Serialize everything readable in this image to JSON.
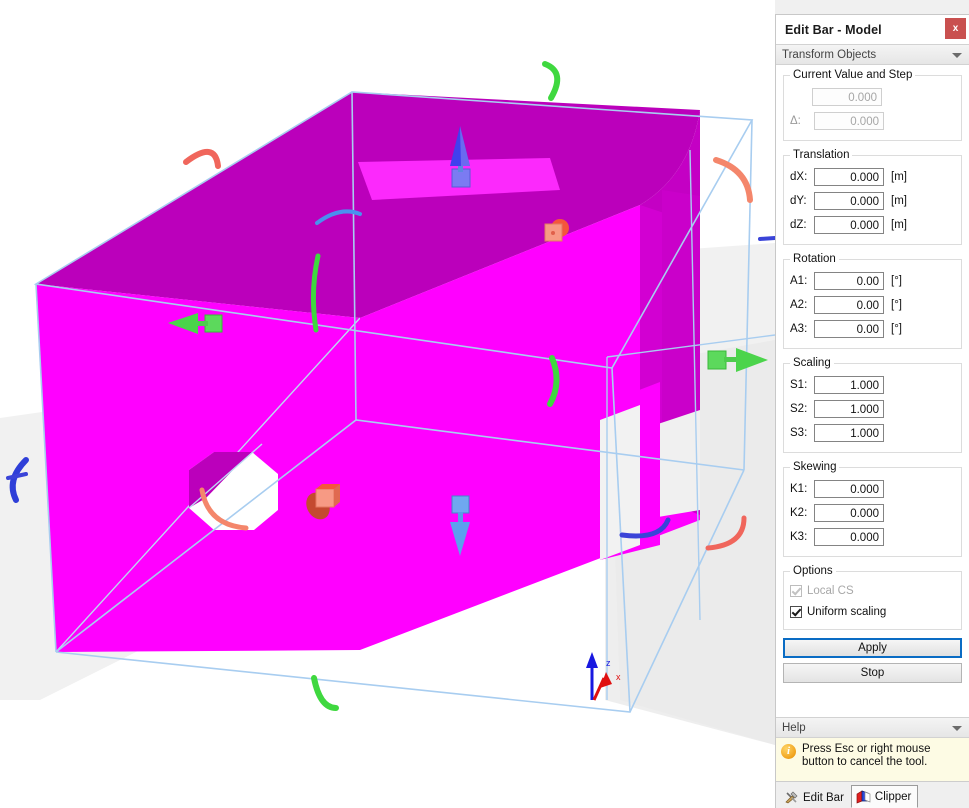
{
  "window": {
    "title": "Edit Bar - Model",
    "close_label": "x"
  },
  "section": {
    "transform_objects": "Transform Objects",
    "collapse_icon": "chevron-down-icon"
  },
  "current_value": {
    "legend": "Current Value and Step",
    "value": "0.000",
    "delta_label": "Δ:",
    "delta_value": "0.000"
  },
  "translation": {
    "legend": "Translation",
    "unit": "[m]",
    "fields": [
      {
        "label": "dX:",
        "value": "0.000",
        "unit": "[m]"
      },
      {
        "label": "dY:",
        "value": "0.000",
        "unit": "[m]"
      },
      {
        "label": "dZ:",
        "value": "0.000",
        "unit": "[m]"
      }
    ]
  },
  "rotation": {
    "legend": "Rotation",
    "fields": [
      {
        "label": "A1:",
        "value": "0.00",
        "unit": "[°]"
      },
      {
        "label": "A2:",
        "value": "0.00",
        "unit": "[°]"
      },
      {
        "label": "A3:",
        "value": "0.00",
        "unit": "[°]"
      }
    ]
  },
  "scaling": {
    "legend": "Scaling",
    "fields": [
      {
        "label": "S1:",
        "value": "1.000",
        "unit": ""
      },
      {
        "label": "S2:",
        "value": "1.000",
        "unit": ""
      },
      {
        "label": "S3:",
        "value": "1.000",
        "unit": ""
      }
    ]
  },
  "skewing": {
    "legend": "Skewing",
    "fields": [
      {
        "label": "K1:",
        "value": "0.000",
        "unit": ""
      },
      {
        "label": "K2:",
        "value": "0.000",
        "unit": ""
      },
      {
        "label": "K3:",
        "value": "0.000",
        "unit": ""
      }
    ]
  },
  "options": {
    "legend": "Options",
    "local_cs": {
      "label": "Local CS",
      "checked": true,
      "enabled": false
    },
    "uniform_scaling": {
      "label": "Uniform scaling",
      "checked": true,
      "enabled": true
    }
  },
  "buttons": {
    "apply": "Apply",
    "stop": "Stop"
  },
  "help": {
    "header": "Help",
    "collapse_icon": "chevron-down-icon",
    "icon": "info-icon",
    "message": "Press Esc or right mouse button to cancel the tool."
  },
  "tabs": [
    {
      "label": "Edit Bar",
      "icon": "tools-icon",
      "active": false
    },
    {
      "label": "Clipper",
      "icon": "clipper-box-icon",
      "active": true
    }
  ],
  "viewport": {
    "axis_z_label": "z",
    "axis_x_label": "x",
    "colors": {
      "solid_front": "#ff00ff",
      "solid_top": "#bb00bb",
      "bbox_edge": "#a8cdf0",
      "gizmo_green": "#4bd44b",
      "gizmo_blue": "#4040ee",
      "gizmo_orange": "#f4866b",
      "arc_red": "#f0665c",
      "arc_blue": "#3a44d8",
      "arc_green": "#3fd83f",
      "clip_plane": "#ec2aec",
      "background": "#ffffff",
      "ground_shadow": "#eeeeee"
    },
    "gizmos": [
      {
        "name": "translate-up-arrow",
        "color": "#4040ee"
      },
      {
        "name": "translate-down-arrow",
        "color": "#4a90ee"
      },
      {
        "name": "translate-left-arrow",
        "color": "#4bd44b"
      },
      {
        "name": "translate-right-arrow",
        "color": "#4bd44b"
      },
      {
        "name": "skew-handle-top",
        "color": "#f4866b"
      },
      {
        "name": "skew-handle-front",
        "color": "#f4866b"
      }
    ]
  }
}
